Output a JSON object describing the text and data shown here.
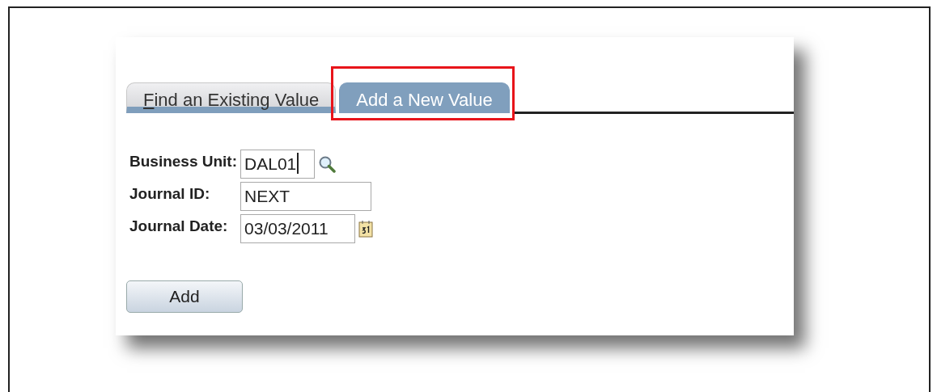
{
  "tabs": [
    {
      "label": "Find an Existing Value",
      "selected": false,
      "highlighted": false
    },
    {
      "label": "Add a New Value",
      "selected": true,
      "highlighted": true
    }
  ],
  "fields": [
    {
      "label": "Business Unit:",
      "value": "DAL01",
      "kind": "lookup",
      "focused": true
    },
    {
      "label": "Journal ID:",
      "value": "NEXT",
      "kind": "plain",
      "focused": false
    },
    {
      "label": "Journal Date:",
      "value": "03/03/2011",
      "kind": "date",
      "focused": false
    }
  ],
  "button": "Add"
}
